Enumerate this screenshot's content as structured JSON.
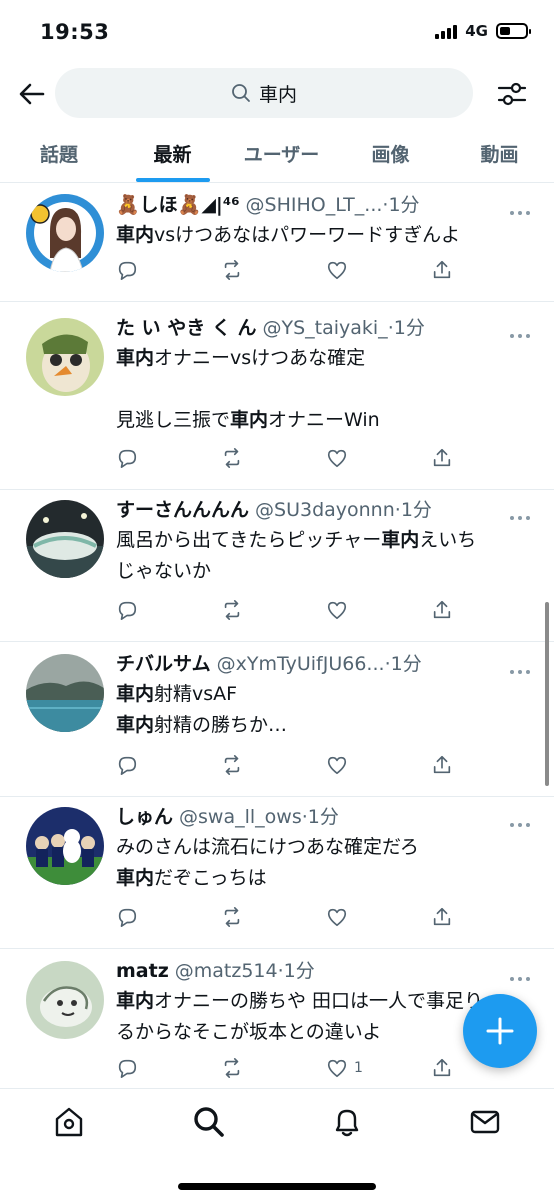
{
  "status_bar": {
    "time": "19:53",
    "network": "4G"
  },
  "search": {
    "query": "車内"
  },
  "tabs": [
    {
      "label": "話題"
    },
    {
      "label": "最新"
    },
    {
      "label": "ユーザー"
    },
    {
      "label": "画像"
    },
    {
      "label": "動画"
    }
  ],
  "tweets": [
    {
      "name": "🧸しほ🧸◢|⁴⁶",
      "handle": "@SHIHO_LT_...",
      "time": "·1分",
      "lines": [
        [
          {
            "t": "車内",
            "b": true
          },
          {
            "t": "vsけつあなはパワーワードすぎんよ"
          }
        ]
      ],
      "like_count": ""
    },
    {
      "name": "た い やき く ん",
      "handle": "@YS_taiyaki_",
      "time": "·1分",
      "lines": [
        [
          {
            "t": "車内",
            "b": true
          },
          {
            "t": "オナニーvsけつあな確定"
          }
        ],
        [
          {
            "t": ""
          }
        ],
        [
          {
            "t": "見逃し三振で"
          },
          {
            "t": "車内",
            "b": true
          },
          {
            "t": "オナニーWin"
          }
        ]
      ],
      "like_count": ""
    },
    {
      "name": "すーさんんんん",
      "handle": "@SU3dayonnn",
      "time": "·1分",
      "lines": [
        [
          {
            "t": "風呂から出てきたらピッチャー"
          },
          {
            "t": "車内",
            "b": true
          },
          {
            "t": "えいち"
          }
        ],
        [
          {
            "t": "じゃないか"
          }
        ]
      ],
      "like_count": ""
    },
    {
      "name": "チバルサム",
      "handle": "@xYmTyUifJU66...",
      "time": "·1分",
      "lines": [
        [
          {
            "t": "車内",
            "b": true
          },
          {
            "t": "射精vsAF"
          }
        ],
        [
          {
            "t": "車内",
            "b": true
          },
          {
            "t": "射精の勝ちか…"
          }
        ]
      ],
      "like_count": ""
    },
    {
      "name": "しゅん",
      "handle": "@swa_ll_ows",
      "time": "·1分",
      "lines": [
        [
          {
            "t": "みのさんは流石にけつあな確定だろ"
          }
        ],
        [
          {
            "t": "車内",
            "b": true
          },
          {
            "t": "だぞこっちは"
          }
        ]
      ],
      "like_count": ""
    },
    {
      "name": "matz",
      "handle": "@matz514",
      "time": "·1分",
      "lines": [
        [
          {
            "t": "車内",
            "b": true
          },
          {
            "t": "オナニーの勝ちや 田口は一人で事足り"
          }
        ],
        [
          {
            "t": "るからなそこが坂本との違いよ"
          }
        ]
      ],
      "like_count": "1"
    }
  ],
  "icons": {
    "back": "arrow-left-icon",
    "search": "search-icon",
    "filter": "sliders-icon",
    "reply": "reply-icon",
    "retweet": "retweet-icon",
    "like": "heart-icon",
    "share": "share-icon",
    "more": "more-dots-icon",
    "compose": "plus-icon",
    "home": "home-icon",
    "explore": "search-icon",
    "notifications": "bell-icon",
    "messages": "mail-icon"
  },
  "colors": {
    "accent": "#1d9bf0",
    "secondary_text": "#536471",
    "primary_text": "#0f1419"
  }
}
